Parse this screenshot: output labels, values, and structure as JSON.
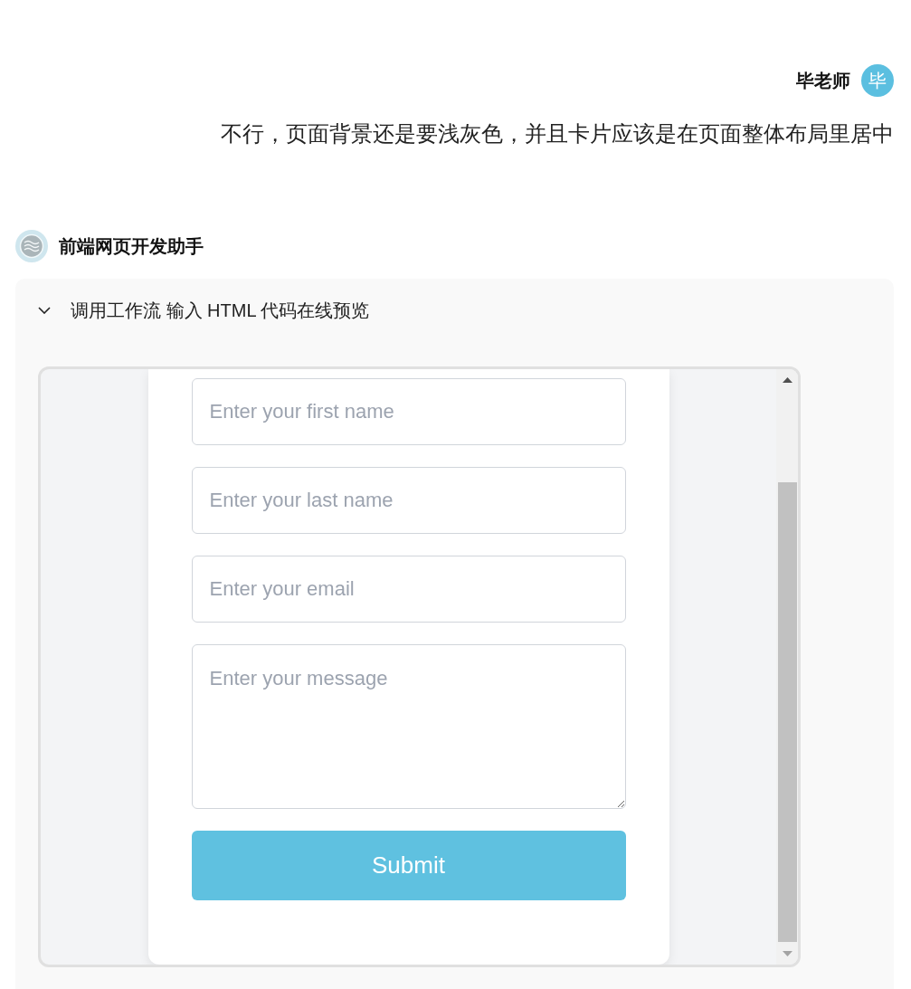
{
  "user_message": {
    "sender": "毕老师",
    "avatar_text": "毕",
    "text": "不行，页面背景还是要浅灰色，并且卡片应该是在页面整体布局里居中"
  },
  "assistant": {
    "name": "前端网页开发助手"
  },
  "workflow_panel": {
    "title": "调用工作流 输入 HTML 代码在线预览",
    "expanded": true,
    "preview": {
      "fields": [
        {
          "kind": "input",
          "placeholder": "Enter your first name"
        },
        {
          "kind": "input",
          "placeholder": "Enter your last name"
        },
        {
          "kind": "input",
          "placeholder": "Enter your email"
        },
        {
          "kind": "textarea",
          "placeholder": "Enter your message"
        }
      ],
      "submit_button": "Submit"
    }
  }
}
